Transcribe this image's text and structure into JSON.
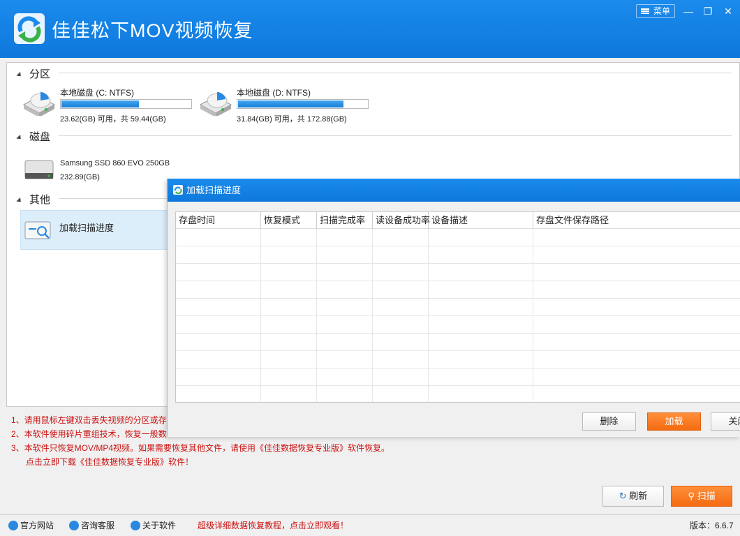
{
  "app": {
    "title": "佳佳松下MOV视频恢复",
    "menu_label": "菜单"
  },
  "window_controls": {
    "minimize": "—",
    "restore": "❐",
    "close": "✕"
  },
  "sections": {
    "partition": "分区",
    "disk": "磁盘",
    "other": "其他"
  },
  "partitions": [
    {
      "name": "本地磁盘 (C: NTFS)",
      "info": "23.62(GB) 可用，共 59.44(GB)",
      "used_fraction": 0.603
    },
    {
      "name": "本地磁盘 (D: NTFS)",
      "info": "31.84(GB) 可用，共 172.88(GB)",
      "used_fraction": 0.816
    }
  ],
  "disks": [
    {
      "name": "Samsung SSD 860 EVO 250GB",
      "size": "232.89(GB)"
    }
  ],
  "other_items": [
    {
      "label": "加载扫描进度"
    }
  ],
  "tips": {
    "line1": "1、请用鼠标左键双击丢失视频的分区或存",
    "line2": "2、本软件使用碎片重组技术，恢复一般数",
    "line3": "3、本软件只恢复MOV/MP4视频。如果需要恢复其他文件，请使用《佳佳数据恢复专业版》软件恢复。",
    "line4": "点击立即下载《佳佳数据恢复专业版》软件！"
  },
  "buttons": {
    "refresh": "刷新",
    "scan": "扫描"
  },
  "footer": {
    "website": "官方网站",
    "support": "咨询客服",
    "about": "关于软件",
    "promo": "超级详细数据恢复教程，点击立即观看！",
    "version": "版本：6.6.7"
  },
  "dialog": {
    "title": "加载扫描进度",
    "columns": [
      "存盘时间",
      "恢复模式",
      "扫描完成率",
      "读设备成功率",
      "设备描述",
      "存盘文件保存路径"
    ],
    "buttons": {
      "delete": "删除",
      "load": "加载",
      "close": "关闭"
    }
  },
  "colors": {
    "accent": "#0e78dc",
    "orange": "#f46b12",
    "tip_red": "#cc1111"
  }
}
